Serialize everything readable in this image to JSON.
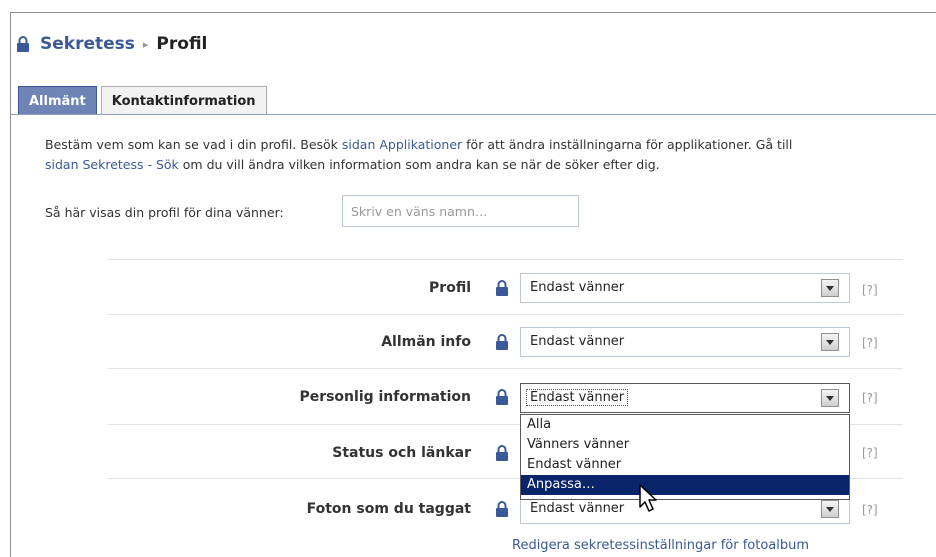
{
  "breadcrumb": {
    "section": "Sekretess",
    "separator": "▸",
    "current": "Profil"
  },
  "tabs": [
    {
      "label": "Allmänt",
      "active": true
    },
    {
      "label": "Kontaktinformation",
      "active": false
    }
  ],
  "intro": {
    "part1": "Bestäm vem som kan se vad i din profil. Besök ",
    "link1": "sidan Applikationer",
    "part2": " för att ändra inställningarna för applikationer. Gå till",
    "link2": "sidan Sekretess - Sök",
    "part3": " om du vill ändra vilken information som andra kan se när de söker efter dig."
  },
  "preview": {
    "label": "Så här visas din profil för dina vänner:",
    "placeholder": "Skriv en väns namn…"
  },
  "rows": [
    {
      "label": "Profil",
      "value": "Endast vänner",
      "help": "[?]"
    },
    {
      "label": "Allmän info",
      "value": "Endast vänner",
      "help": "[?]"
    },
    {
      "label": "Personlig information",
      "value": "Endast vänner",
      "help": "[?]"
    },
    {
      "label": "Status och länkar",
      "value": "",
      "help": "[?]"
    },
    {
      "label": "Foton som du taggat",
      "value": "Endast vänner",
      "help": "[?]"
    }
  ],
  "dropdown": {
    "options": [
      "Alla",
      "Vänners vänner",
      "Endast vänner",
      "Anpassa…"
    ],
    "highlighted": "Anpassa…"
  },
  "album_link": "Redigera sekretessinställningar för fotoalbum",
  "colors": {
    "brand": "#3b5998",
    "tab_active": "#6d84b4",
    "highlight": "#0a246a"
  }
}
